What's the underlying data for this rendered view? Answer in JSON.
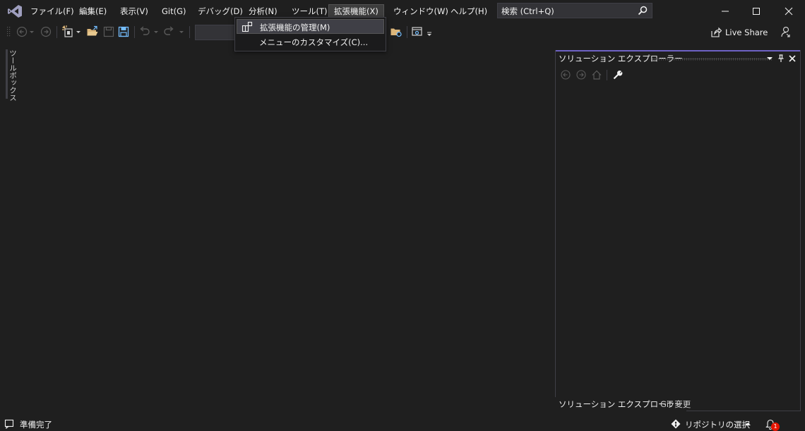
{
  "menu": {
    "file": "ファイル(F)",
    "edit": "編集(E)",
    "view": "表示(V)",
    "git": "Git(G)",
    "debug": "デバッグ(D)",
    "analyze": "分析(N)",
    "tools": "ツール(T)",
    "extensions": "拡張機能(X)",
    "window": "ウィンドウ(W)",
    "help": "ヘルプ(H)"
  },
  "search": {
    "label": "検索 (Ctrl+Q)"
  },
  "extensions_menu": {
    "items": [
      {
        "label": "拡張機能の管理(M)",
        "icon": "manage-extensions-icon"
      },
      {
        "label": "メニューのカスタマイズ(C)..."
      }
    ]
  },
  "toolbar": {
    "liveshare_label": "Live Share"
  },
  "toolbox": {
    "label": "ツールボックス"
  },
  "solution_explorer": {
    "title": "ソリューション エクスプローラー",
    "tabs": [
      "ソリューション エクスプローラー",
      "Git 変更"
    ]
  },
  "status": {
    "text": "準備完了",
    "repo_label": "リポジトリの選択",
    "notification_count": "1"
  },
  "colors": {
    "background": "#1f1f1f",
    "accent": "#6e62c4",
    "logo": "#9f9fbf",
    "save_blue": "#75beff",
    "folder_yellow": "#dcb67a",
    "badge_red": "#e51400"
  }
}
